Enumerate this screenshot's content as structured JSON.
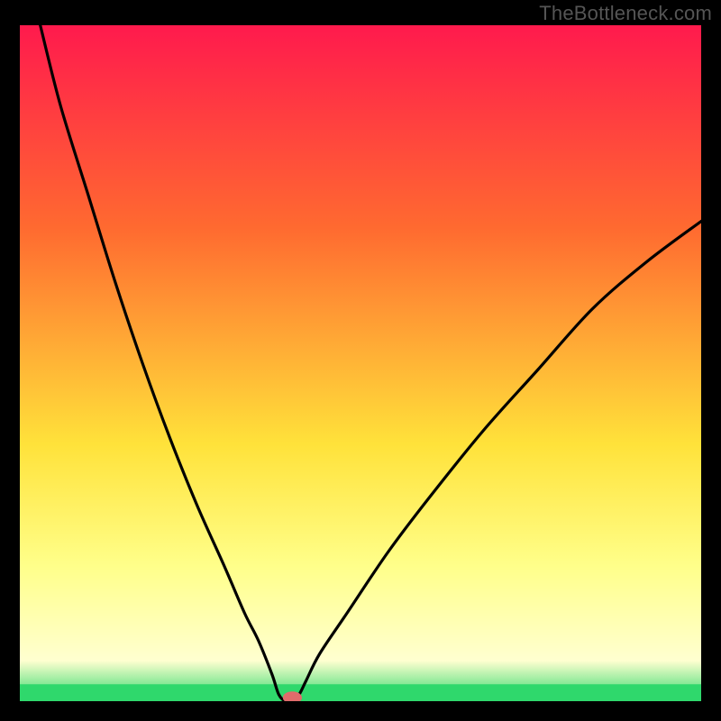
{
  "watermark": "TheBottleneck.com",
  "chart_data": {
    "type": "line",
    "title": "",
    "xlabel": "",
    "ylabel": "",
    "xlim": [
      0,
      100
    ],
    "ylim": [
      0,
      100
    ],
    "grid": false,
    "background_gradient": {
      "stops": [
        {
          "offset": 0,
          "color": "#ff1a4d"
        },
        {
          "offset": 30,
          "color": "#ff6a30"
        },
        {
          "offset": 62,
          "color": "#ffe23a"
        },
        {
          "offset": 80,
          "color": "#ffff8a"
        },
        {
          "offset": 94,
          "color": "#ffffd0"
        },
        {
          "offset": 100,
          "color": "#2fd86c"
        }
      ]
    },
    "green_band_y": [
      97.5,
      100
    ],
    "curve_note": "Single V-shaped black curve: left branch starts at top-left, descends steeply and curves to a minimum near x≈38–40 at y≈100, then right branch rises more gently and exits near right edge at y≈29.",
    "series": [
      {
        "name": "bottleneck-curve",
        "x": [
          3,
          6,
          10,
          14,
          18,
          22,
          26,
          30,
          33,
          35,
          37,
          38,
          39,
          40,
          41,
          42,
          44,
          48,
          54,
          60,
          68,
          76,
          84,
          92,
          100
        ],
        "y": [
          0,
          12,
          25,
          38,
          50,
          61,
          71,
          80,
          87,
          91,
          96,
          99,
          100,
          100,
          99,
          97,
          93,
          87,
          78,
          70,
          60,
          51,
          42,
          35,
          29
        ],
        "color": "#000000"
      }
    ],
    "marker": {
      "x": 40,
      "y": 100,
      "color": "#e06b6b",
      "rx": 1.4,
      "ry": 0.9
    }
  }
}
